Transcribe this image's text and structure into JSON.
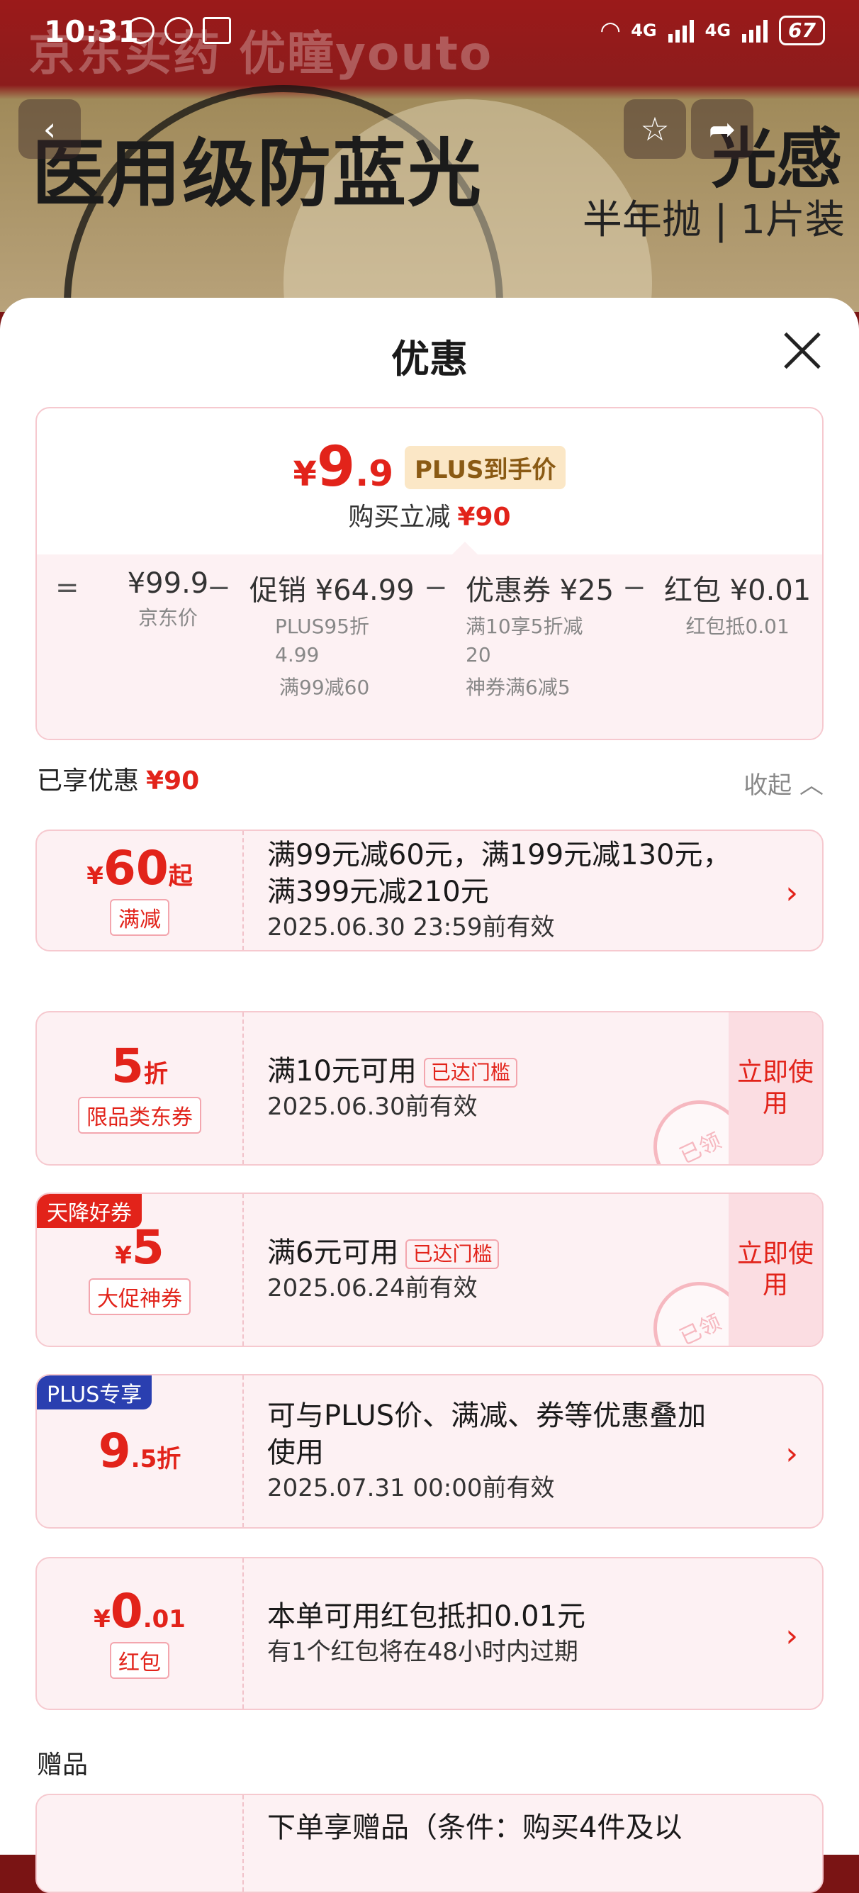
{
  "status_bar": {
    "time": "10:31",
    "signal_1": "4G",
    "signal_2": "4G",
    "battery": "67"
  },
  "background": {
    "brand": "京东买药 优瞳youto",
    "headline": "医用级防蓝光",
    "headline_right": "光感",
    "subline": "半年抛 | 1片装"
  },
  "sheet": {
    "title": "优惠",
    "summary": {
      "currency": "¥",
      "price_int": "9",
      "price_dec": ".9",
      "plus_tag": "PLUS到手价",
      "reduce_label": "购买立减",
      "reduce_value": "¥90",
      "breakdown": [
        {
          "op": "=",
          "head": "¥99.9",
          "notes": [
            "京东价"
          ]
        },
        {
          "op": "−",
          "head": "促销 ¥64.99",
          "notes": [
            "PLUS95折",
            "4.99",
            "满99减60"
          ]
        },
        {
          "op": "−",
          "head": "优惠券 ¥25",
          "notes": [
            "满10享5折减",
            "20",
            "神券满6减5"
          ]
        },
        {
          "op": "−",
          "head": "红包 ¥0.01",
          "notes": [
            "红包抵0.01"
          ]
        }
      ]
    },
    "enjoyed": {
      "label": "已享优惠",
      "value": "¥90",
      "collapse": "收起"
    },
    "cards": [
      {
        "currency": "¥",
        "big": "60",
        "suffix": "起",
        "tag": "满减",
        "line1": "满99元减60元，满199元减130元，",
        "line2": "满399元减210元",
        "line3": "2025.06.30 23:59前有效"
      },
      {
        "big": "5",
        "suffix": "折",
        "tag": "限品类东券",
        "line1": "满10元可用",
        "badge": "已达门槛",
        "line2": "2025.06.30前有效",
        "action": "立即使用",
        "stamp": "已领"
      },
      {
        "ribbon": "天降好券",
        "currency": "¥",
        "big": "5",
        "tag": "大促神券",
        "line1": "满6元可用",
        "badge": "已达门槛",
        "line2": "2025.06.24前有效",
        "action": "立即使用",
        "stamp": "已领"
      },
      {
        "ribbon": "PLUS专享",
        "big": "9",
        "suffix": ".5折",
        "line1": "可与PLUS价、满减、券等优惠叠加",
        "line2": "使用",
        "line3": "2025.07.31 00:00前有效"
      },
      {
        "currency": "¥",
        "big": "0",
        "suffix": ".01",
        "tag": "红包",
        "line1": "本单可用红包抵扣0.01元",
        "line2": "有1个红包将在48小时内过期"
      }
    ],
    "gifts": {
      "label": "赠品",
      "line1": "下单享赠品（条件：购买4件及以"
    }
  },
  "colors": {
    "accent": "#e2231a",
    "card_bg": "#fdf1f3",
    "plus_ribbon": "#2a3fb0",
    "promo_ribbon": "#e2231a"
  }
}
